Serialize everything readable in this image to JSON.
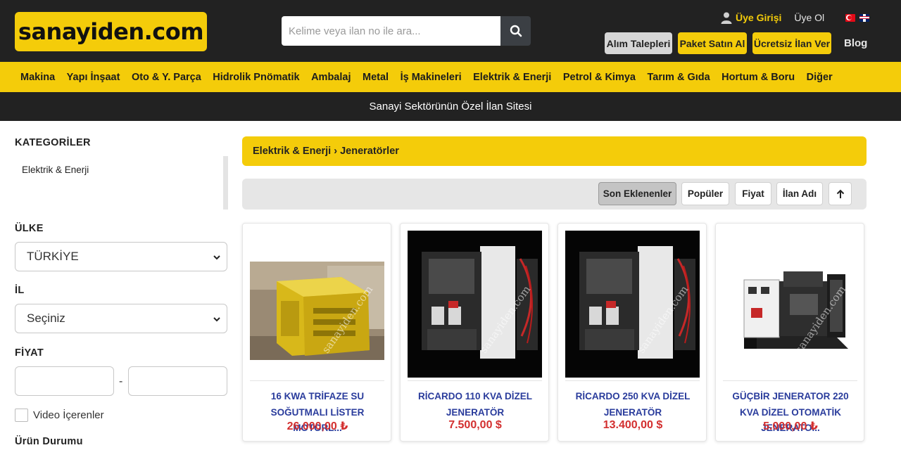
{
  "header": {
    "logo": "sanayiden.com",
    "search_placeholder": "Kelime veya ilan no ile ara...",
    "login": "Üye Girişi",
    "register": "Üye Ol",
    "buttons": [
      "Alım Talepleri",
      "Paket Satın Al",
      "Ücretsiz İlan Ver"
    ],
    "blog": "Blog"
  },
  "categories": [
    "Makina",
    "Yapı İnşaat",
    "Oto & Y. Parça",
    "Hidrolik Pnömatik",
    "Ambalaj",
    "Metal",
    "İş Makineleri",
    "Elektrik & Enerji",
    "Petrol & Kimya",
    "Tarım & Gıda",
    "Hortum & Boru",
    "Diğer"
  ],
  "slogan": "Sanayi Sektörünün Özel İlan Sitesi",
  "sidebar": {
    "categories_title": "KATEGORİLER",
    "category_item": "Elektrik & Enerji",
    "country_title": "ÜLKE",
    "country_value": "TÜRKİYE",
    "city_title": "İL",
    "city_value": "Seçiniz",
    "price_title": "FİYAT",
    "price_separator": "-",
    "video_label": "Video İçerenler",
    "condition_title": "Ürün Durumu"
  },
  "breadcrumb": "Elektrik & Enerji › Jeneratörler",
  "sort": {
    "options": [
      "Son Eklenenler",
      "Popüler",
      "Fiyat",
      "İlan Adı"
    ],
    "active": "Son Eklenenler"
  },
  "watermark": "sanayiden.com",
  "listings": [
    {
      "title": "16 KWA TRİFAZE SU SOĞUTMALI LİSTER MOTORL...",
      "price": "26.000,00 ₺"
    },
    {
      "title": "RİCARDO 110 KVA DİZEL JENERATÖR",
      "price": "7.500,00 $"
    },
    {
      "title": "RİCARDO 250 KVA DİZEL JENERATÖR",
      "price": "13.400,00 $"
    },
    {
      "title": "GÜÇBİR JENERATOR 220 KVA DİZEL OTOMATİK JENERATO...",
      "price": "5.000,00 ₺"
    }
  ],
  "colors": {
    "accent": "#f4cc0a",
    "dark": "#222222",
    "title": "#2a3c9c",
    "price": "#d32f2f"
  }
}
